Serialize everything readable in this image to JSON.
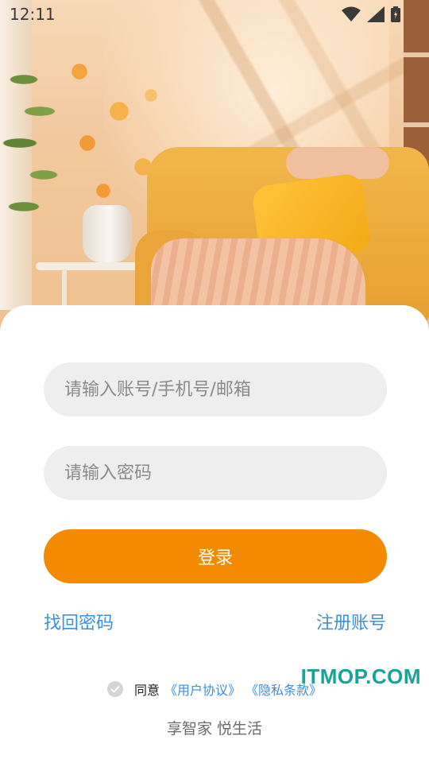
{
  "status_bar": {
    "time": "12:11",
    "icons": [
      "wifi-icon",
      "cellular-signal-icon",
      "battery-icon"
    ]
  },
  "hero": {
    "image": "living-room-illustration"
  },
  "login": {
    "account_placeholder": "请输入账号/手机号/邮箱",
    "password_placeholder": "请输入密码",
    "login_label": "登录",
    "forgot_label": "找回密码",
    "register_label": "注册账号"
  },
  "agreement": {
    "prefix": "同意",
    "user_agreement": "《用户协议》",
    "privacy_policy": "《隐私条款》",
    "checked": false
  },
  "slogan": "享智家 悦生活",
  "watermark": "ITMOP.COM",
  "colors": {
    "accent": "#f38a00",
    "link": "#3d8fe0",
    "field_bg": "#eeeeee"
  }
}
